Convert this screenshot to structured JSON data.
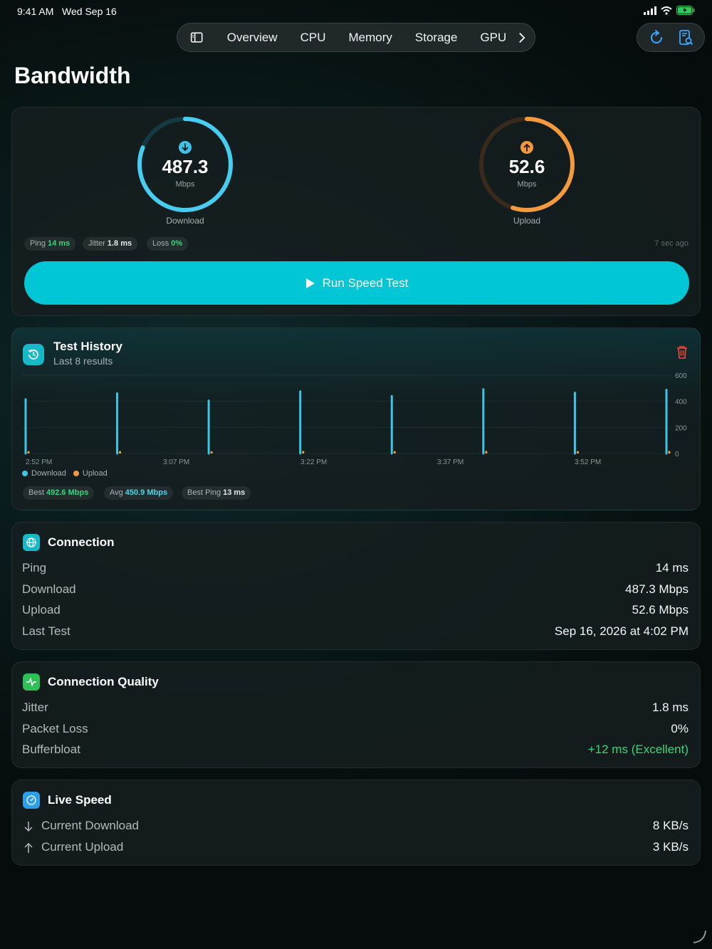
{
  "status": {
    "time": "9:41 AM",
    "date": "Wed Sep 16"
  },
  "nav": {
    "items": [
      "Overview",
      "CPU",
      "Memory",
      "Storage",
      "GPU"
    ]
  },
  "page": {
    "title": "Bandwidth"
  },
  "speed": {
    "download": {
      "value": "487.3",
      "unit": "Mbps",
      "label": "Download",
      "fraction": 0.81
    },
    "upload": {
      "value": "52.6",
      "unit": "Mbps",
      "label": "Upload",
      "fraction": 0.55
    },
    "chips": [
      {
        "label": "Ping",
        "value": "14 ms",
        "color": "#34d77b"
      },
      {
        "label": "Jitter",
        "value": "1.8 ms",
        "color": "#e6e9ea"
      },
      {
        "label": "Loss",
        "value": "0%",
        "color": "#34d77b"
      }
    ],
    "ago": "7 sec  ago",
    "run_label": "Run Speed Test"
  },
  "history": {
    "title": "Test History",
    "subtitle": "Last 8 results",
    "legend": {
      "download": "Download",
      "upload": "Upload"
    },
    "stats": [
      {
        "label": "Best",
        "value": "492.6 Mbps",
        "color": "#34d77b"
      },
      {
        "label": "Avg",
        "value": "450.9 Mbps",
        "color": "#4fd6ea"
      },
      {
        "label": "Best Ping",
        "value": "13 ms",
        "color": "#e6e9ea"
      }
    ]
  },
  "chart_data": {
    "type": "bar",
    "x_tick_labels": [
      "2:52 PM",
      "3:07 PM",
      "3:22 PM",
      "3:37 PM",
      "3:52 PM"
    ],
    "y_ticks": [
      0,
      200,
      400,
      600
    ],
    "ylim": [
      0,
      600
    ],
    "series": [
      {
        "name": "Download",
        "color": "#3cc6e6",
        "values": [
          415,
          460,
          405,
          475,
          440,
          492.6,
          465,
          487.3
        ]
      },
      {
        "name": "Upload",
        "color": "#f29a3a",
        "values": [
          48,
          50,
          47,
          52,
          49,
          53,
          51,
          52.6
        ]
      }
    ]
  },
  "connection": {
    "title": "Connection",
    "rows": [
      {
        "label": "Ping",
        "value": "14 ms"
      },
      {
        "label": "Download",
        "value": "487.3 Mbps"
      },
      {
        "label": "Upload",
        "value": "52.6 Mbps"
      },
      {
        "label": "Last Test",
        "value": "Sep 16, 2026 at 4:02 PM"
      }
    ]
  },
  "quality": {
    "title": "Connection Quality",
    "rows": [
      {
        "label": "Jitter",
        "value": "1.8 ms"
      },
      {
        "label": "Packet Loss",
        "value": "0%"
      },
      {
        "label": "Bufferbloat",
        "value": "+12 ms (Excellent)",
        "color": "#34d77b"
      }
    ]
  },
  "live": {
    "title": "Live Speed",
    "rows": [
      {
        "label": "Current Download",
        "value": "8 KB/s"
      },
      {
        "label": "Current Upload",
        "value": "3 KB/s"
      }
    ]
  }
}
